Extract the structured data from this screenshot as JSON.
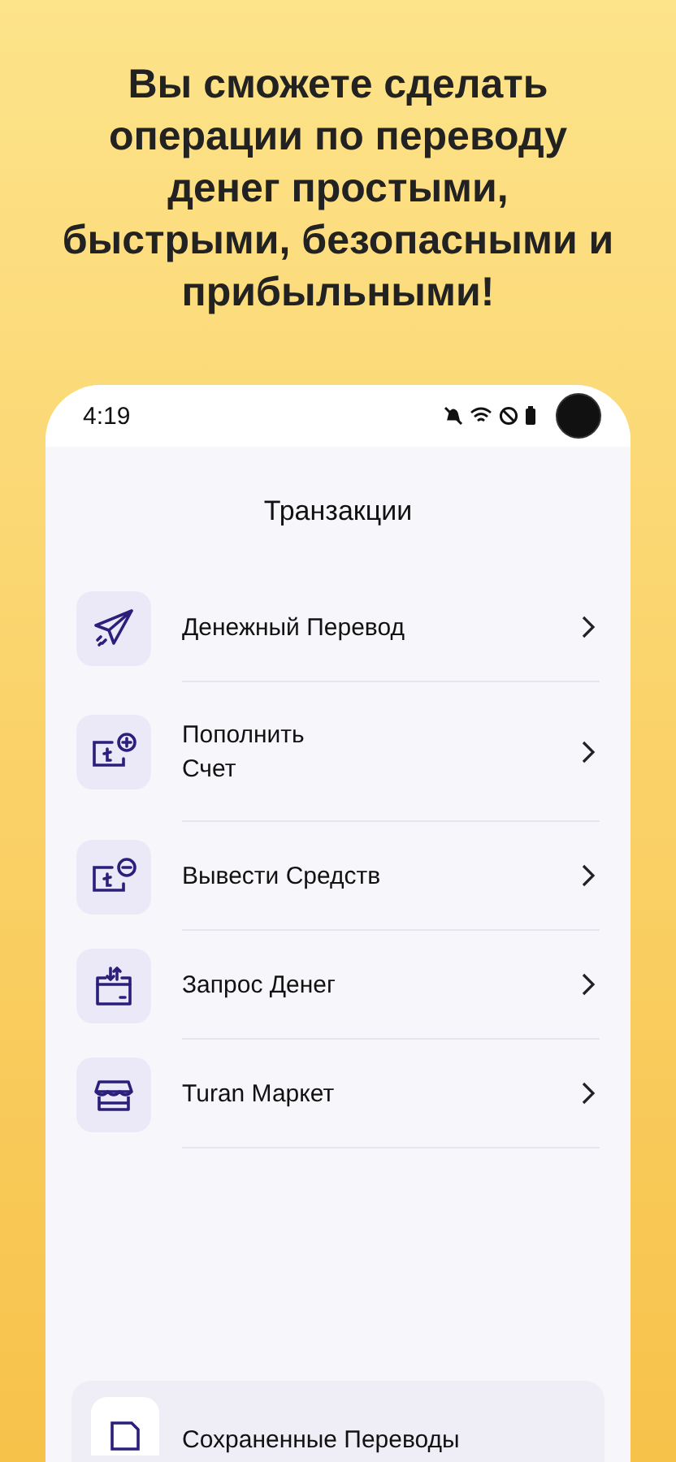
{
  "headline_lines": [
    "Вы сможете сделать",
    "операции по переводу",
    "денег простыми,",
    "быстрыми, безопасными и",
    "прибыльными!"
  ],
  "status_bar": {
    "time": "4:19"
  },
  "screen": {
    "title": "Транзакции",
    "items": [
      {
        "kind": "plane",
        "label": "Денежный Перевод"
      },
      {
        "kind": "deposit",
        "label": "Пополнить\nСчет"
      },
      {
        "kind": "withdraw",
        "label": "Вывести Средств"
      },
      {
        "kind": "request",
        "label": "Запрос Денег"
      },
      {
        "kind": "market",
        "label": "Turan Маркет"
      }
    ],
    "saved": {
      "kind": "save",
      "label": "Сохраненные Переводы"
    }
  }
}
